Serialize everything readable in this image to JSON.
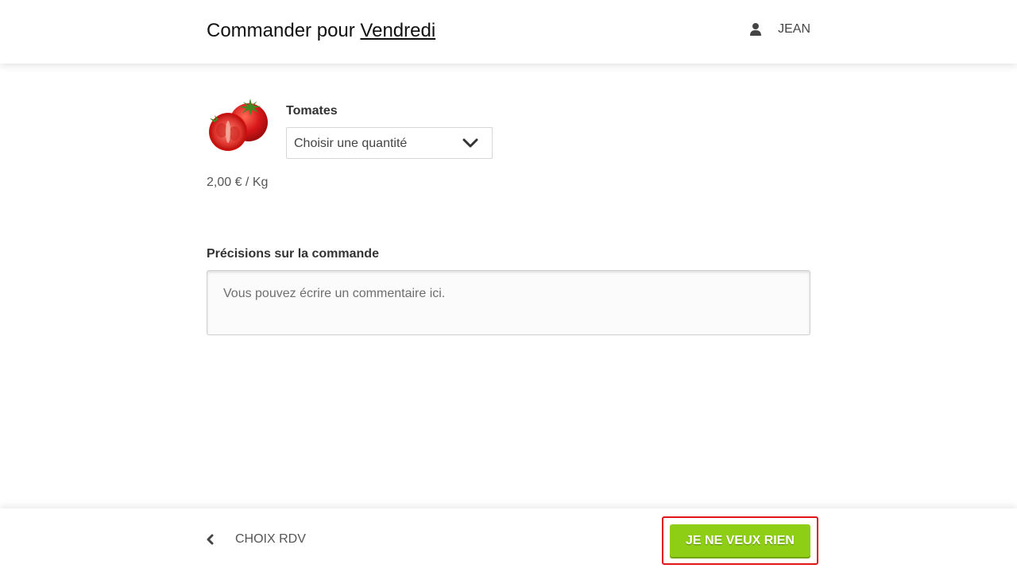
{
  "header": {
    "title_prefix": "Commander pour ",
    "day_link": "Vendredi",
    "user_name": "JEAN",
    "user_icon": "user-icon"
  },
  "product": {
    "image_icon": "tomato-image",
    "name": "Tomates",
    "quantity_select": {
      "selected": "Choisir une quantité",
      "icon": "chevron-down-icon"
    },
    "price": "2,00 € / Kg"
  },
  "notes": {
    "label": "Précisions sur la commande",
    "placeholder": "Vous pouvez écrire un commentaire ici.",
    "value": ""
  },
  "footer": {
    "back_label": "CHOIX RDV",
    "back_icon": "chevron-left-icon",
    "primary_label": "JE NE VEUX RIEN"
  },
  "colors": {
    "primary": "#8ecf16",
    "highlight": "#e0141b",
    "text": "#333333"
  }
}
